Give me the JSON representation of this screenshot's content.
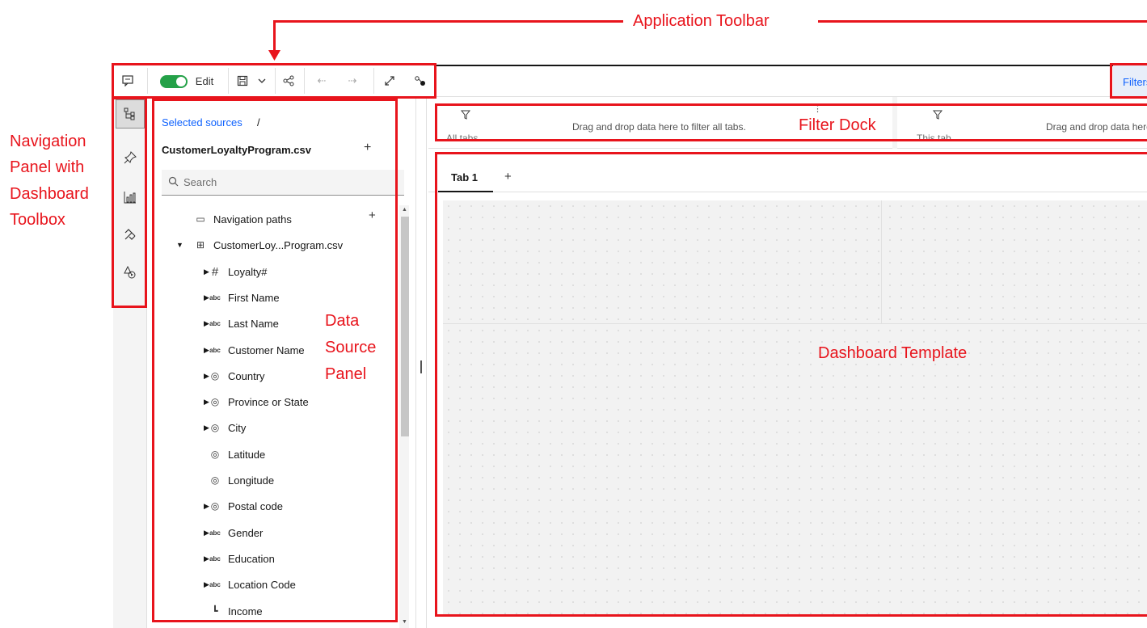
{
  "callouts": {
    "application_toolbar": "Application Toolbar",
    "navigation_panel": [
      "Navigation",
      "Panel with",
      "Dashboard",
      "Toolbox"
    ],
    "data_source_panel": [
      "Data",
      "Source",
      "Panel"
    ],
    "filter_dock": "Filter Dock",
    "dashboard_template": "Dashboard Template"
  },
  "toolbar": {
    "edit_label": "Edit",
    "filters_label": "Filters"
  },
  "data_source": {
    "breadcrumb_link": "Selected sources",
    "breadcrumb_sep": "/",
    "file_name": "CustomerLoyaltyProgram.csv",
    "add_label": "+",
    "more_label": "⋮",
    "search_placeholder": "Search",
    "tree": [
      {
        "label": "Navigation paths",
        "icon": "▭",
        "caret": "",
        "add": "+"
      },
      {
        "label": "CustomerLoy...Program.csv",
        "icon": "⊞",
        "caret": "▼"
      },
      {
        "label": "Loyalty#",
        "icon": "#",
        "caret": "▶"
      },
      {
        "label": "First Name",
        "icon": "abc",
        "caret": "▶"
      },
      {
        "label": "Last Name",
        "icon": "abc",
        "caret": "▶"
      },
      {
        "label": "Customer Name",
        "icon": "abc",
        "caret": "▶"
      },
      {
        "label": "Country",
        "icon": "◎",
        "caret": "▶"
      },
      {
        "label": "Province or State",
        "icon": "◎",
        "caret": "▶"
      },
      {
        "label": "City",
        "icon": "◎",
        "caret": "▶"
      },
      {
        "label": "Latitude",
        "icon": "◎",
        "caret": ""
      },
      {
        "label": "Longitude",
        "icon": "◎",
        "caret": ""
      },
      {
        "label": "Postal code",
        "icon": "◎",
        "caret": "▶"
      },
      {
        "label": "Gender",
        "icon": "abc",
        "caret": "▶"
      },
      {
        "label": "Education",
        "icon": "abc",
        "caret": "▶"
      },
      {
        "label": "Location Code",
        "icon": "abc",
        "caret": "▶"
      },
      {
        "label": "Income",
        "icon": "┗",
        "caret": ""
      }
    ]
  },
  "filter_dock": {
    "all_tabs_label": "All tabs",
    "all_tabs_hint": "Drag and drop data here to filter all tabs.",
    "this_tab_label": "This tab",
    "this_tab_hint": "Drag and drop data here to filter this tab."
  },
  "tabs": {
    "tab1_label": "Tab 1",
    "add_label": "+"
  },
  "colors": {
    "annotation": "#e8141c",
    "link": "#0f62fe",
    "toggle_on": "#24a148"
  }
}
